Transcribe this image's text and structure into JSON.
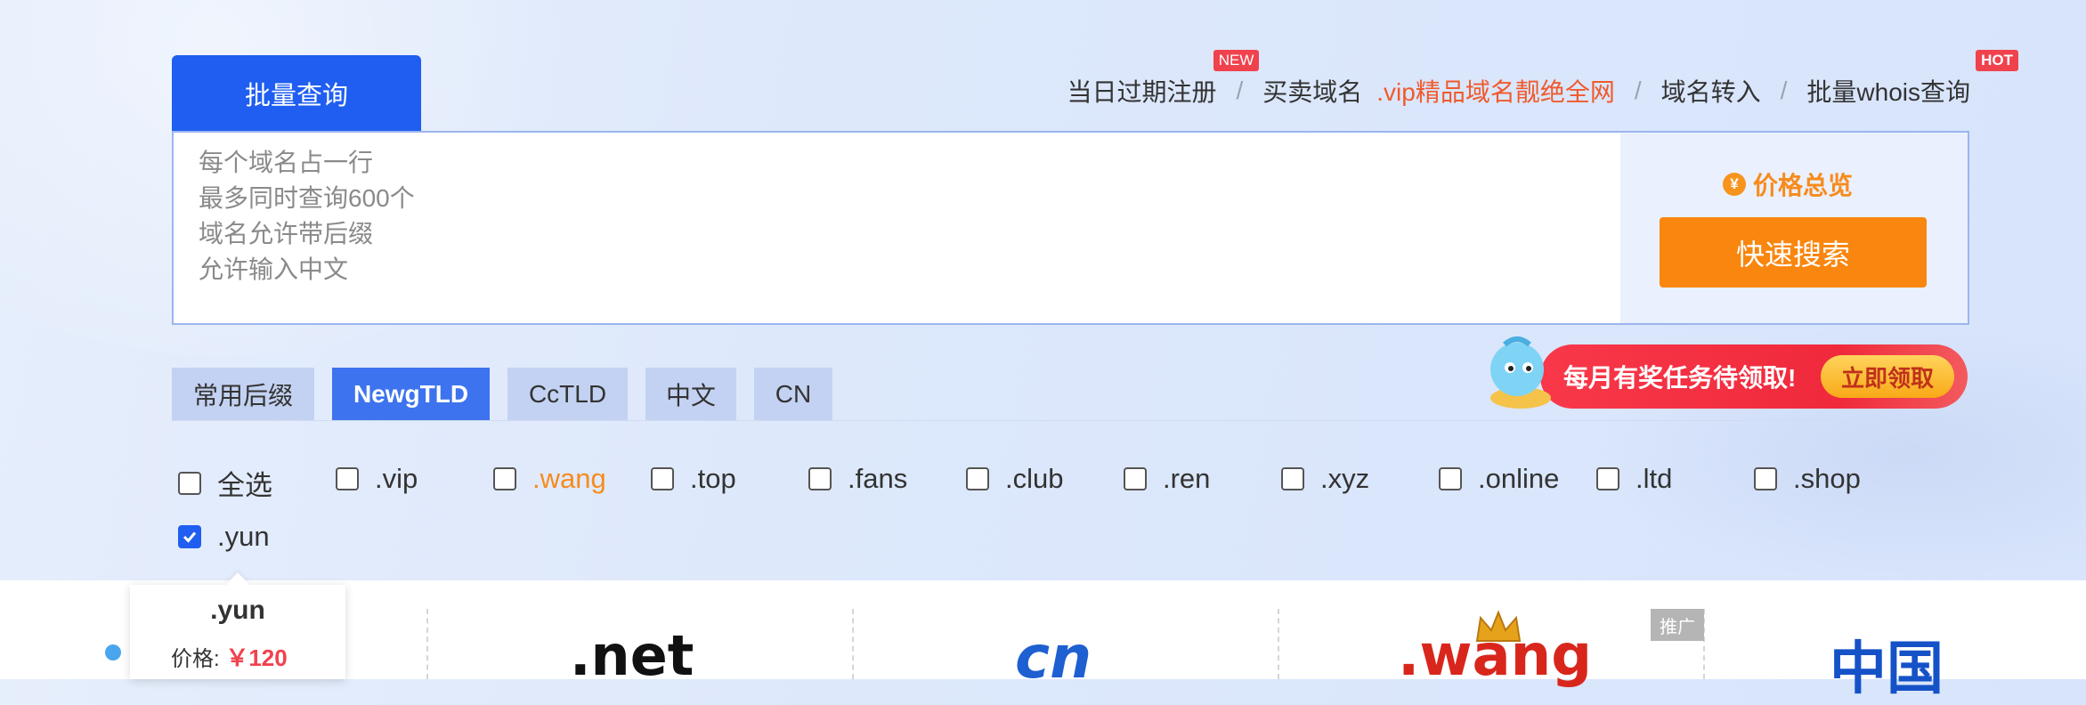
{
  "search_tabs": {
    "batch": "批量查询"
  },
  "top_links": {
    "expiring": "当日过期注册",
    "expiring_badge": "NEW",
    "buy_sell": "买卖域名",
    "promo": ".vip精品域名靓绝全网",
    "transfer": "域名转入",
    "whois": "批量whois查询",
    "whois_badge": "HOT",
    "separator": "/"
  },
  "search": {
    "placeholder_lines": [
      "每个域名占一行",
      "最多同时查询600个",
      "域名允许带后缀",
      "允许输入中文"
    ],
    "price_overview": "价格总览",
    "coin_symbol": "¥",
    "quick_search": "快速搜索"
  },
  "category_tabs": [
    {
      "label": "常用后缀",
      "active": false
    },
    {
      "label": "NewgTLD",
      "active": true
    },
    {
      "label": "CcTLD",
      "active": false
    },
    {
      "label": "中文",
      "active": false
    },
    {
      "label": "CN",
      "active": false
    }
  ],
  "reward_banner": {
    "text": "每月有奖任务待领取!",
    "button": "立即领取"
  },
  "suffixes": [
    {
      "label": "全选",
      "checked": false,
      "highlight": false
    },
    {
      "label": ".vip",
      "checked": false,
      "highlight": false
    },
    {
      "label": ".wang",
      "checked": false,
      "highlight": true
    },
    {
      "label": ".top",
      "checked": false,
      "highlight": false
    },
    {
      "label": ".fans",
      "checked": false,
      "highlight": false
    },
    {
      "label": ".club",
      "checked": false,
      "highlight": false
    },
    {
      "label": ".ren",
      "checked": false,
      "highlight": false
    },
    {
      "label": ".xyz",
      "checked": false,
      "highlight": false
    },
    {
      "label": ".online",
      "checked": false,
      "highlight": false
    },
    {
      "label": ".ltd",
      "checked": false,
      "highlight": false
    },
    {
      "label": ".shop",
      "checked": false,
      "highlight": false
    },
    {
      "label": ".yun",
      "checked": true,
      "highlight": false
    }
  ],
  "tooltip": {
    "name": ".yun",
    "price_label": "价格:",
    "price_value": "￥120"
  },
  "bottom_cards": {
    "net": ".net",
    "cn": "cn",
    "wang": ".wang",
    "zh": "中国",
    "ad_tag": "推广"
  },
  "colors": {
    "primary": "#1f5ef0",
    "orange": "#f9860f",
    "red": "#f0424d"
  }
}
